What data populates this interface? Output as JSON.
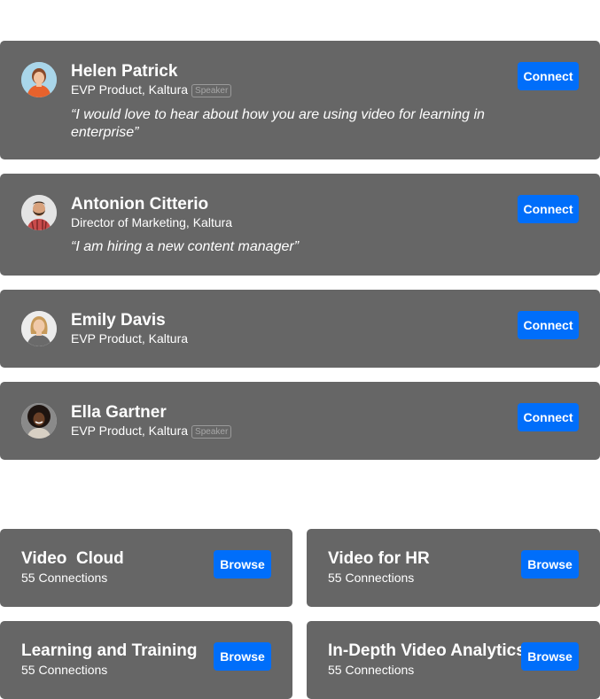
{
  "people": [
    {
      "name": "Helen Patrick",
      "role": "EVP Product, Kaltura",
      "badge": "Speaker",
      "quote": "“I would love to hear about how you are using video for learning in enterprise”",
      "button": "Connect",
      "avatar_icon": "person-orange-shirt-avatar"
    },
    {
      "name": "Antonion Citterio",
      "role": "Director of Marketing, Kaltura",
      "quote": "“I am hiring a new content manager”",
      "button": "Connect",
      "avatar_icon": "person-bearded-avatar"
    },
    {
      "name": "Emily Davis",
      "role": "EVP Product, Kaltura",
      "button": "Connect",
      "avatar_icon": "person-blonde-avatar"
    },
    {
      "name": "Ella Gartner",
      "role": "EVP Product, Kaltura",
      "badge": "Speaker",
      "button": "Connect",
      "avatar_icon": "person-curly-hair-avatar"
    }
  ],
  "groups": [
    {
      "title": "Video  Cloud",
      "subtitle": "55 Connections",
      "button": "Browse"
    },
    {
      "title": "Video for HR",
      "subtitle": "55 Connections",
      "button": "Browse"
    },
    {
      "title": "Learning and Training",
      "subtitle": "55 Connections",
      "button": "Browse"
    },
    {
      "title": "In-Depth Video Analytics",
      "subtitle": "55 Connections",
      "button": "Browse"
    }
  ],
  "colors": {
    "card_bg": "#666666",
    "button_bg": "#006efa",
    "text": "#ffffff",
    "badge_border": "#9a9a9a"
  }
}
